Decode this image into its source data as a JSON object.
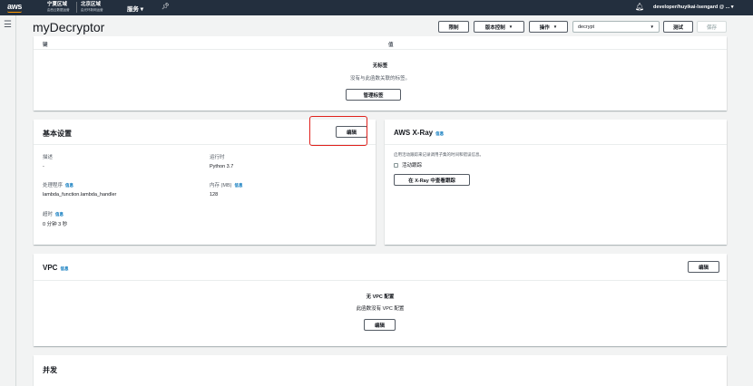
{
  "topnav": {
    "logo": "aws",
    "region1_title": "宁夏区域",
    "region1_sub": "由西云数据运营",
    "region2_title": "北京区域",
    "region2_sub": "由光环新网运营",
    "services": "服务 ▾",
    "pin_icon": "pin-icon",
    "bell_icon": "bell-icon",
    "user": "developer/huyikai-lsengard @ ... ▾"
  },
  "header": {
    "title": "myDecryptor",
    "btn_throttle": "限制",
    "btn_version": "版本控制",
    "btn_actions": "操作",
    "select_value": "decrypt",
    "btn_test": "测试",
    "btn_save": "保存"
  },
  "tags": {
    "col_key": "键",
    "col_value": "值",
    "empty_title": "无标签",
    "empty_desc": "没有与此函数关联的标签。",
    "manage_btn": "管理标签"
  },
  "basic": {
    "heading": "基本设置",
    "edit_btn": "编辑",
    "desc_label": "描述",
    "desc_value": "-",
    "runtime_label": "运行时",
    "runtime_value": "Python 3.7",
    "handler_label": "处理程序",
    "handler_value": "lambda_function.lambda_handler",
    "memory_label": "内存 (MB)",
    "memory_value": "128",
    "timeout_label": "超时",
    "timeout_value": "0 分钟  3 秒",
    "info": "信息"
  },
  "xray": {
    "heading": "AWS X-Ray",
    "info": "信息",
    "desc": "启用活动跟踪来记录调用子集的时间和错误信息。",
    "checkbox_label": "活动跟踪",
    "view_btn": "在 X-Ray 中查看跟踪"
  },
  "vpc": {
    "heading": "VPC",
    "info": "信息",
    "edit_btn": "编辑",
    "empty_title": "无 VPC 配置",
    "empty_desc": "此函数没有 VPC 配置",
    "edit_btn2": "编辑"
  },
  "concurrency": {
    "heading": "并发"
  }
}
